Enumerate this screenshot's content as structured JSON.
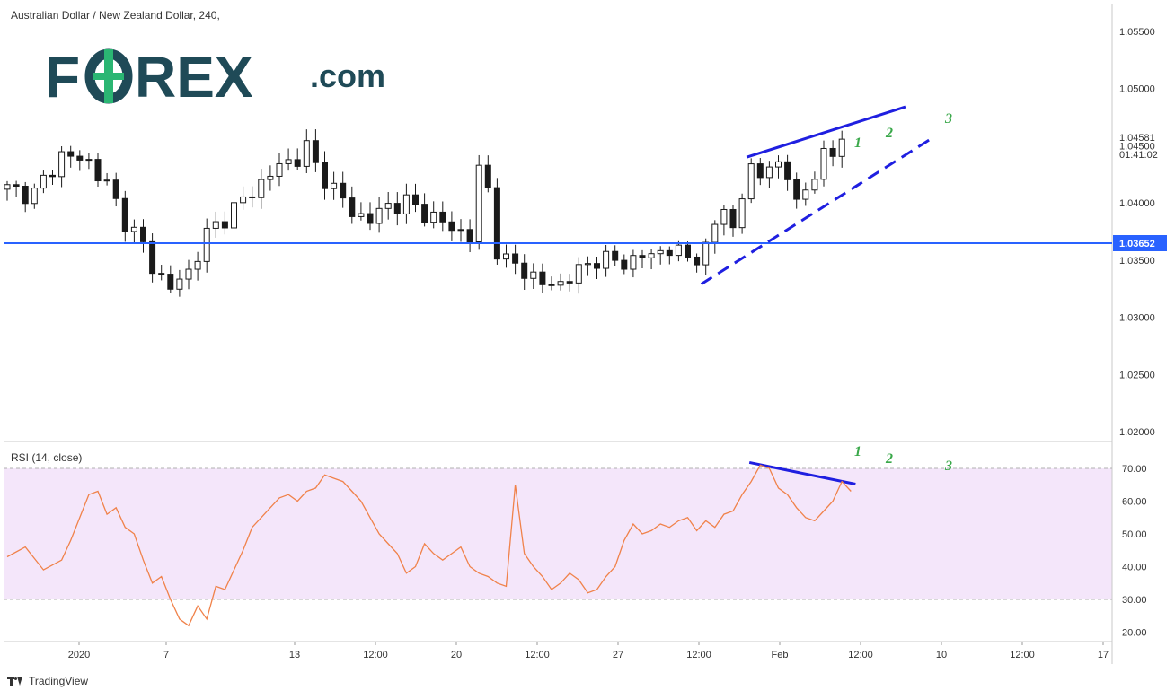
{
  "header": {
    "title": "Australian Dollar / New Zealand Dollar, 240,"
  },
  "logo": {
    "text_left": "F",
    "text_o": "O",
    "text_right": "REX",
    "text_com": ".com",
    "accent": "#2bb673"
  },
  "rsi_panel": {
    "title": "RSI (14, close)"
  },
  "price_axis": {
    "ticks": [
      "1.05500",
      "1.05000",
      "1.04500",
      "1.04000",
      "1.03500",
      "1.03000",
      "1.02500",
      "1.02000"
    ],
    "last_price": "1.04581",
    "countdown": "01:41:02",
    "level_label": "1.03652"
  },
  "rsi_axis": {
    "ticks": [
      "70.00",
      "60.00",
      "50.00",
      "40.00",
      "30.00",
      "20.00"
    ]
  },
  "time_axis": {
    "ticks": [
      "2020",
      "7",
      "13",
      "12:00",
      "20",
      "12:00",
      "27",
      "12:00",
      "Feb",
      "12:00",
      "10",
      "12:00",
      "17"
    ]
  },
  "markers": {
    "price": [
      "1",
      "2",
      "3"
    ],
    "rsi": [
      "1",
      "2",
      "3"
    ]
  },
  "footer": {
    "brand": "TradingView"
  },
  "colors": {
    "up_candle": "#ffffff",
    "down_candle": "#1a1a1a",
    "level_line": "#2962ff",
    "trend_line": "#1f1fe0",
    "rsi_line": "#f0824a",
    "rsi_band": "#f4e6fa",
    "marker": "#3aa84a"
  },
  "chart_data": [
    {
      "type": "candlestick",
      "title": "Australian Dollar / New Zealand Dollar, 240,",
      "ylim": [
        1.0195,
        1.0565
      ],
      "y_ticks": [
        1.055,
        1.05,
        1.045,
        1.04,
        1.035,
        1.03,
        1.025,
        1.02
      ],
      "horizontal_level": 1.03652,
      "last_price": 1.04581,
      "close_path": [
        {
          "x": 0,
          "close": 1.0412
        },
        {
          "x": 3,
          "close": 1.0408
        },
        {
          "x": 6,
          "close": 1.0442
        },
        {
          "x": 9,
          "close": 1.0436
        },
        {
          "x": 11,
          "close": 1.0415
        },
        {
          "x": 13,
          "close": 1.0385
        },
        {
          "x": 15,
          "close": 1.0362
        },
        {
          "x": 16,
          "close": 1.0345
        },
        {
          "x": 18,
          "close": 1.0325
        },
        {
          "x": 20,
          "close": 1.034
        },
        {
          "x": 22,
          "close": 1.0372
        },
        {
          "x": 24,
          "close": 1.0388
        },
        {
          "x": 26,
          "close": 1.0402
        },
        {
          "x": 28,
          "close": 1.0418
        },
        {
          "x": 30,
          "close": 1.0432
        },
        {
          "x": 32,
          "close": 1.044
        },
        {
          "x": 33,
          "close": 1.0448
        },
        {
          "x": 34,
          "close": 1.0432
        },
        {
          "x": 36,
          "close": 1.0412
        },
        {
          "x": 38,
          "close": 1.0392
        },
        {
          "x": 40,
          "close": 1.0385
        },
        {
          "x": 42,
          "close": 1.0398
        },
        {
          "x": 44,
          "close": 1.04
        },
        {
          "x": 46,
          "close": 1.0392
        },
        {
          "x": 48,
          "close": 1.0382
        },
        {
          "x": 50,
          "close": 1.0375
        },
        {
          "x": 51,
          "close": 1.037
        },
        {
          "x": 52,
          "close": 1.0428
        },
        {
          "x": 53,
          "close": 1.0412
        },
        {
          "x": 54,
          "close": 1.036
        },
        {
          "x": 55,
          "close": 1.0348
        },
        {
          "x": 57,
          "close": 1.0342
        },
        {
          "x": 59,
          "close": 1.0328
        },
        {
          "x": 61,
          "close": 1.033
        },
        {
          "x": 63,
          "close": 1.034
        },
        {
          "x": 65,
          "close": 1.0352
        },
        {
          "x": 67,
          "close": 1.0348
        },
        {
          "x": 69,
          "close": 1.035
        },
        {
          "x": 71,
          "close": 1.0355
        },
        {
          "x": 73,
          "close": 1.036
        },
        {
          "x": 75,
          "close": 1.0352
        },
        {
          "x": 77,
          "close": 1.0358
        },
        {
          "x": 78,
          "close": 1.038
        },
        {
          "x": 79,
          "close": 1.04
        },
        {
          "x": 80,
          "close": 1.0375
        },
        {
          "x": 81,
          "close": 1.0405
        },
        {
          "x": 82,
          "close": 1.0432
        },
        {
          "x": 83,
          "close": 1.0422
        },
        {
          "x": 84,
          "close": 1.0438
        },
        {
          "x": 85,
          "close": 1.0428
        },
        {
          "x": 86,
          "close": 1.042
        },
        {
          "x": 87,
          "close": 1.0412
        },
        {
          "x": 88,
          "close": 1.0404
        },
        {
          "x": 89,
          "close": 1.042
        },
        {
          "x": 90,
          "close": 1.0452
        },
        {
          "x": 91,
          "close": 1.0438
        },
        {
          "x": 92,
          "close": 1.0458
        }
      ],
      "dashed_support_trendline": [
        {
          "x": 76.5,
          "y": 1.0329
        },
        {
          "x": 102,
          "y": 1.0457
        }
      ],
      "solid_resistance_trendline": [
        {
          "x": 81.5,
          "y": 1.044
        },
        {
          "x": 99,
          "y": 1.0484
        }
      ]
    },
    {
      "type": "line",
      "title": "RSI (14, close)",
      "ylim": [
        16,
        74
      ],
      "y_ticks": [
        70,
        60,
        50,
        40,
        30,
        20
      ],
      "band": [
        30,
        70
      ],
      "x": [
        0,
        2,
        4,
        6,
        7,
        8,
        9,
        10,
        11,
        12,
        13,
        14,
        15,
        16,
        17,
        18,
        19,
        20,
        21,
        22,
        23,
        24,
        25,
        26,
        27,
        28,
        29,
        30,
        31,
        32,
        33,
        34,
        35,
        36,
        37,
        38,
        39,
        40,
        41,
        42,
        43,
        44,
        45,
        46,
        47,
        48,
        49,
        50,
        51,
        52,
        53,
        54,
        55,
        56,
        57,
        58,
        59,
        60,
        61,
        62,
        63,
        64,
        65,
        66,
        67,
        68,
        69,
        70,
        71,
        72,
        73,
        74,
        75,
        76,
        77,
        78,
        79,
        80,
        81,
        82,
        83,
        84,
        85,
        86,
        87,
        88,
        89,
        90,
        91,
        92,
        93
      ],
      "values": [
        43,
        46,
        39,
        42,
        48,
        55,
        62,
        63,
        56,
        58,
        52,
        50,
        42,
        35,
        37,
        30,
        24,
        22,
        28,
        24,
        34,
        33,
        39,
        45,
        52,
        55,
        58,
        61,
        62,
        60,
        63,
        64,
        68,
        67,
        66,
        63,
        60,
        55,
        50,
        47,
        44,
        38,
        40,
        47,
        44,
        42,
        44,
        46,
        40,
        38,
        37,
        35,
        34,
        65,
        44,
        40,
        37,
        33,
        35,
        38,
        36,
        32,
        33,
        37,
        40,
        48,
        53,
        50,
        51,
        53,
        52,
        54,
        55,
        51,
        54,
        52,
        56,
        57,
        62,
        66,
        71,
        70,
        64,
        62,
        58,
        55,
        54,
        57,
        60,
        66,
        63,
        65
      ],
      "descending_trendline": [
        {
          "x": 81.8,
          "y": 71.8
        },
        {
          "x": 93.5,
          "y": 65.2
        }
      ]
    }
  ]
}
